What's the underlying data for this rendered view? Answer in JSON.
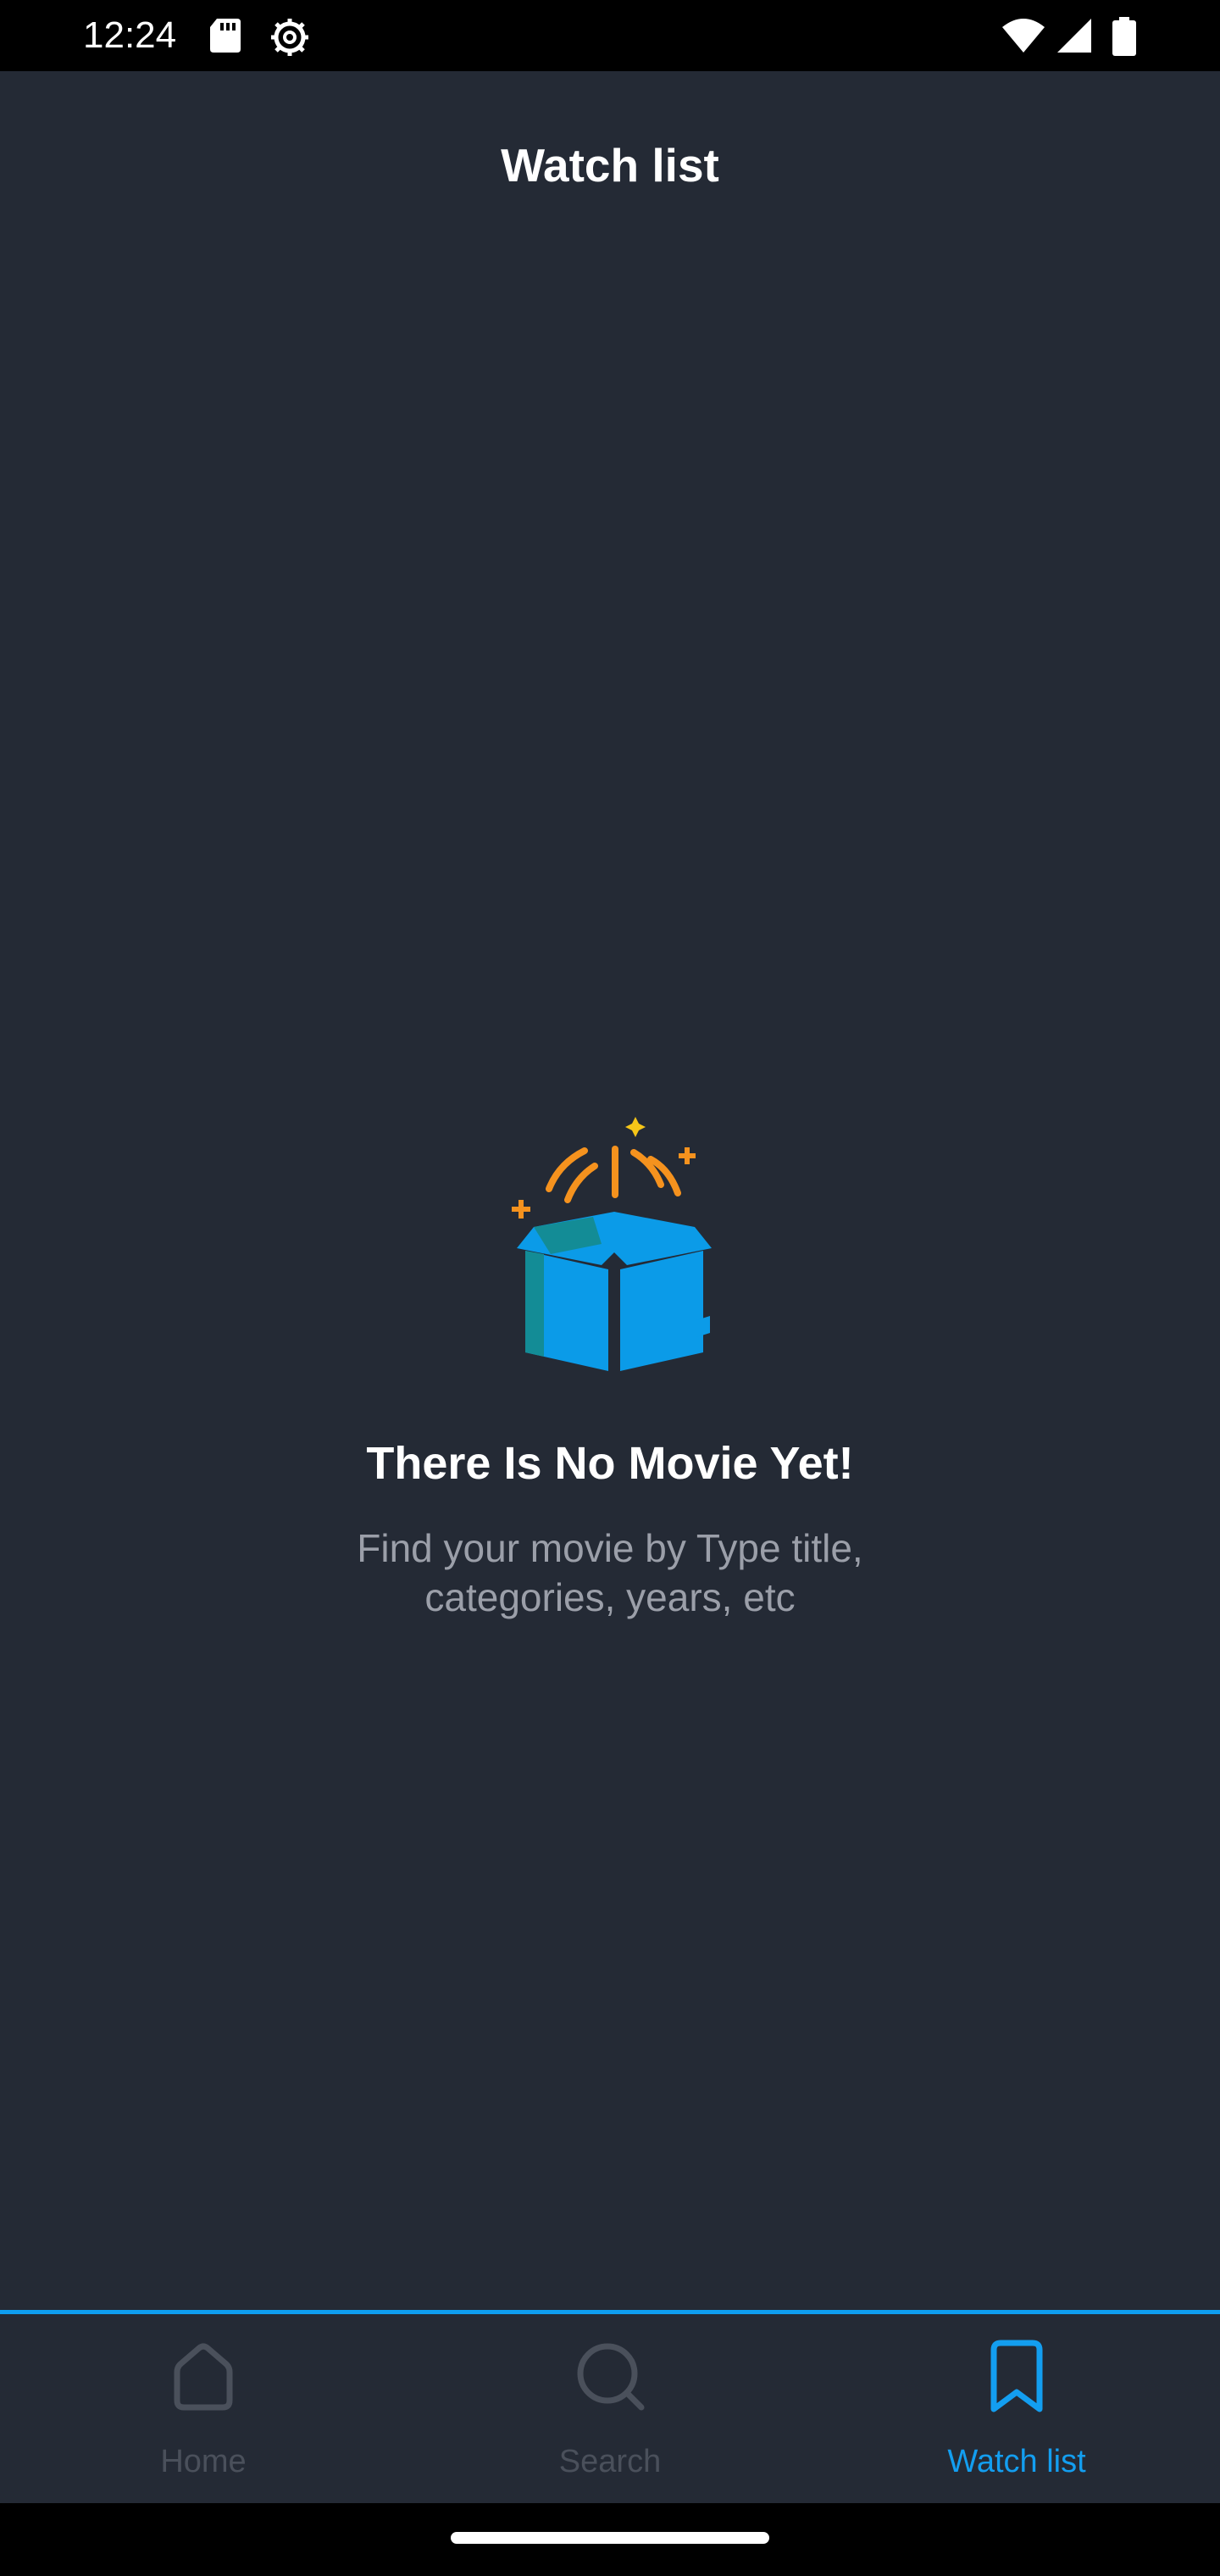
{
  "status_bar": {
    "time": "12:24",
    "icons": [
      "sd-card-icon",
      "gear-icon",
      "wifi-icon",
      "signal-icon",
      "battery-icon"
    ]
  },
  "header": {
    "title": "Watch list"
  },
  "empty_state": {
    "icon": "open-gift-box-icon",
    "title": "There Is No Movie Yet!",
    "subtitle": "Find your movie by Type title, categories, years, etc"
  },
  "bottom_nav": {
    "items": [
      {
        "label": "Home",
        "icon": "home-icon",
        "active": false
      },
      {
        "label": "Search",
        "icon": "search-icon",
        "active": false
      },
      {
        "label": "Watch list",
        "icon": "bookmark-icon",
        "active": true
      }
    ]
  },
  "colors": {
    "background": "#242a35",
    "accent": "#139ef0",
    "inactive": "#4a505b",
    "muted_text": "#9b9fa9",
    "illustration_orange": "#f5921e",
    "illustration_blue": "#0b9be8",
    "illustration_teal": "#138c96"
  }
}
